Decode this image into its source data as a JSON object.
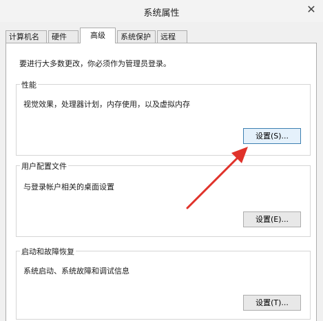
{
  "window": {
    "title": "系统属性",
    "close_glyph": "✕"
  },
  "tabs": [
    {
      "label": "计算机名"
    },
    {
      "label": "硬件"
    },
    {
      "label": "高级"
    },
    {
      "label": "系统保护"
    },
    {
      "label": "远程"
    }
  ],
  "active_tab": "高级",
  "notice": "要进行大多数更改，你必须作为管理员登录。",
  "groups": {
    "performance": {
      "title": "性能",
      "description": "视觉效果，处理器计划，内存使用，以及虚拟内存",
      "button": "设置(S)..."
    },
    "user_profiles": {
      "title": "用户配置文件",
      "description": "与登录帐户相关的桌面设置",
      "button": "设置(E)..."
    },
    "startup_recovery": {
      "title": "启动和故障恢复",
      "description": "系统启动、系统故障和调试信息",
      "button": "设置(T)..."
    }
  },
  "colors": {
    "annotation_arrow": "#e0322a",
    "focus_border": "#3c7fb1"
  },
  "annotation": {
    "type": "arrow",
    "points_to": "performance-settings-button"
  }
}
